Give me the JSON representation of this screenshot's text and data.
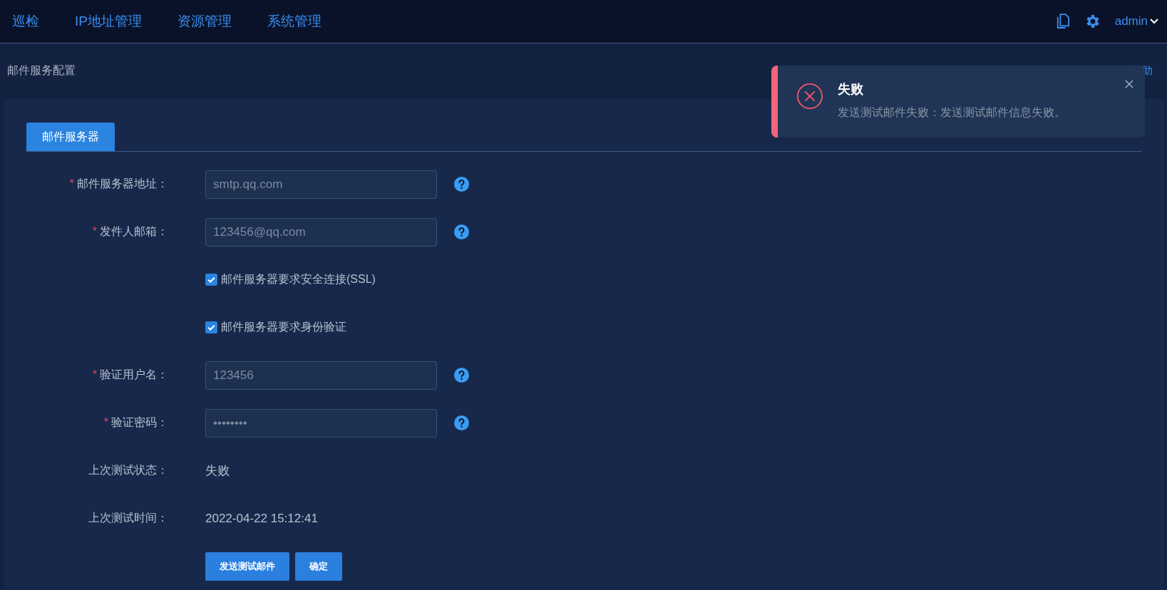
{
  "nav": {
    "items": [
      "巡检",
      "IP地址管理",
      "资源管理",
      "系统管理"
    ],
    "user": "admin"
  },
  "page": {
    "title": "邮件服务配置",
    "help": "助"
  },
  "tabs": [
    {
      "label": "邮件服务器",
      "selected": true
    }
  ],
  "fields": [
    {
      "kind": "input",
      "required_mark": "*",
      "label": "邮件服务器地址：",
      "value": "smtp.qq.com"
    },
    {
      "kind": "input",
      "required_mark": "*",
      "label": "发件人邮箱：",
      "value": "123456@qq.com"
    },
    {
      "kind": "checkbox",
      "label": "邮件服务器要求安全连接(SSL)",
      "checked": true
    },
    {
      "kind": "checkbox",
      "label": "邮件服务器要求身份验证",
      "checked": true
    },
    {
      "kind": "input",
      "required_mark": "*",
      "label": "验证用户名：",
      "value": "123456"
    },
    {
      "kind": "input",
      "required_mark": "*",
      "label": "验证密码：",
      "value": "••••••••"
    },
    {
      "kind": "text",
      "label": "上次测试状态：",
      "value": "失败"
    },
    {
      "kind": "text",
      "label": "上次测试时间：",
      "value": "2022-04-22 15:12:41"
    }
  ],
  "buttons": [
    "发送测试邮件",
    "确定"
  ],
  "toast": {
    "title": "失败",
    "message": "发送测试邮件失败：发送测试邮件信息失败。"
  }
}
